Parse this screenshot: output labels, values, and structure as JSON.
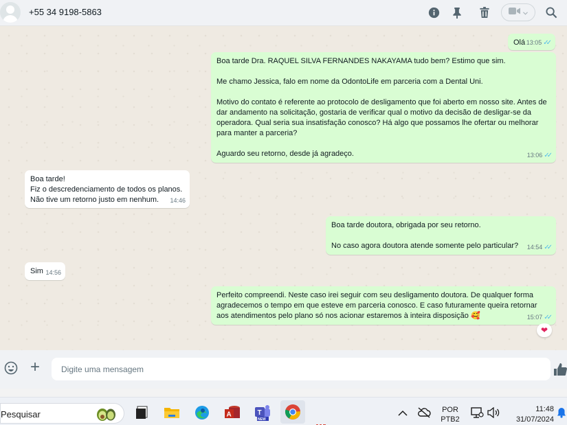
{
  "header": {
    "contact_name": "+55 34 9198-5863",
    "icons": [
      "info-icon",
      "pin-icon",
      "trash-icon",
      "video-call-icon",
      "chevron-down-icon",
      "search-icon"
    ]
  },
  "messages": [
    {
      "direction": "out",
      "text": "Olá",
      "time": "13:05",
      "status": "read"
    },
    {
      "direction": "out",
      "text": "Boa tarde Dra. RAQUEL SILVA FERNANDES NAKAYAMA tudo bem? Estimo que sim.\n\nMe chamo Jessica, falo em nome da OdontoLife em parceria com a Dental Uni.\n\nMotivo do contato é referente ao protocolo de desligamento que foi aberto em nosso site. Antes de dar andamento na solicitação, gostaria de verificar qual o motivo da decisão de desligar-se da operadora. Qual seria sua insatisfação conosco? Há algo que possamos lhe ofertar ou melhorar para manter a parceria?\n\nAguardo seu retorno, desde já agradeço.",
      "time": "13:06",
      "status": "read"
    },
    {
      "direction": "in",
      "text": "Boa tarde!\nFiz o descredenciamento de todos os planos.\nNão tive um retorno justo em nenhum.",
      "time": "14:46"
    },
    {
      "direction": "out",
      "text": "Boa tarde doutora, obrigada por seu retorno.\n\nNo caso agora doutora atende somente pelo particular?",
      "time": "14:54",
      "status": "read"
    },
    {
      "direction": "in",
      "text": "Sim",
      "time": "14:56"
    },
    {
      "direction": "out",
      "text": "Perfeito compreendi. Neste caso irei seguir com seu desligamento doutora. De qualquer forma agradecemos o tempo em que esteve em parceria conosco. E caso futuramente queira retornar aos atendimentos pelo plano só nos acionar estaremos à inteira disposição 🥰",
      "time": "15:07",
      "status": "read",
      "reaction": "❤"
    }
  ],
  "composer": {
    "placeholder": "Digite uma mensagem"
  },
  "taskbar": {
    "search_placeholder": "Pesquisar",
    "apps": [
      "file-explorer-icon",
      "folder-icon",
      "edge-icon",
      "access-icon",
      "teams-icon",
      "chrome-icon"
    ],
    "language_line1": "POR",
    "language_line2": "PTB2",
    "time": "11:48",
    "date": "31/07/2024"
  },
  "colors": {
    "outgoing_bubble": "#d9fdd3",
    "incoming_bubble": "#ffffff",
    "chat_background": "#efeae2",
    "read_ticks": "#53bdeb"
  }
}
